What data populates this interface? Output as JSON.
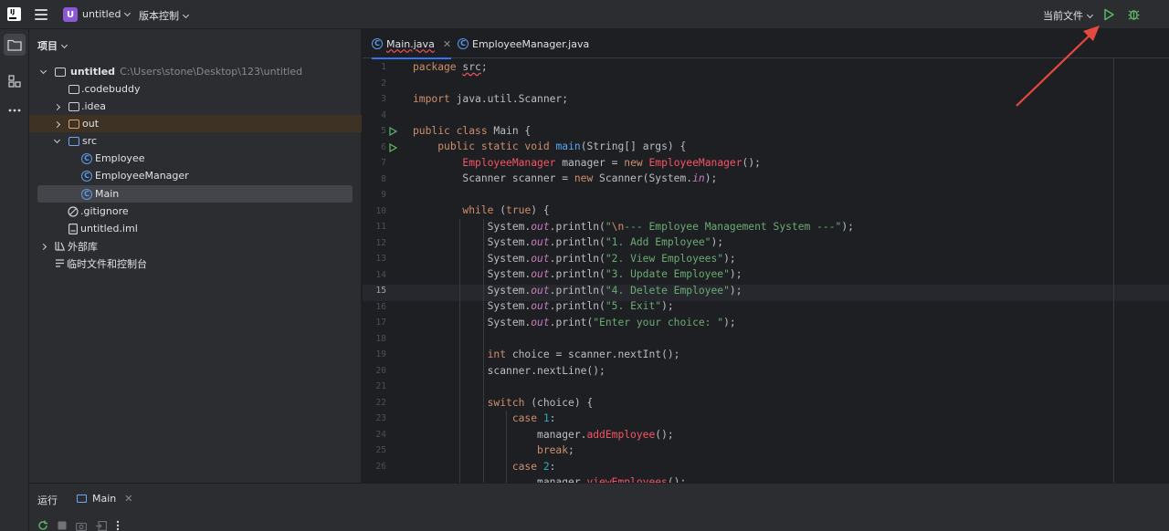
{
  "titlebar": {
    "project_badge": "U",
    "project_name": "untitled",
    "vcs_label": "版本控制",
    "run_config": "当前文件"
  },
  "project_panel": {
    "title": "项目",
    "tree": [
      {
        "label": "untitled",
        "hint": "C:\\Users\\stone\\Desktop\\123\\untitled"
      },
      {
        "label": ".codebuddy"
      },
      {
        "label": ".idea"
      },
      {
        "label": "out"
      },
      {
        "label": "src"
      },
      {
        "label": "Employee"
      },
      {
        "label": "EmployeeManager"
      },
      {
        "label": "Main"
      },
      {
        "label": ".gitignore"
      },
      {
        "label": "untitled.iml"
      },
      {
        "label": "外部库"
      },
      {
        "label": "临时文件和控制台"
      }
    ]
  },
  "editor": {
    "tabs": [
      {
        "label": "Main.java"
      },
      {
        "label": "EmployeeManager.java"
      }
    ],
    "current_line": 15,
    "line_numbers": [
      "1",
      "2",
      "3",
      "4",
      "5",
      "6",
      "7",
      "8",
      "9",
      "10",
      "11",
      "12",
      "13",
      "14",
      "15",
      "16",
      "17",
      "18",
      "19",
      "20",
      "21",
      "22",
      "23",
      "24",
      "25",
      "26"
    ]
  },
  "run_panel": {
    "title": "运行",
    "tab_label": "Main"
  },
  "colors": {
    "accent": "#3574f0",
    "run_green": "#5fb865",
    "badge_purple": "#8c58d6",
    "annotation_arrow": "#e5483f"
  },
  "icons": [
    "app-logo-icon",
    "hamburger-icon",
    "chevron-down-icon",
    "run-icon",
    "debug-icon",
    "folder-icon",
    "structure-icon",
    "more-icon",
    "class-icon",
    "rerun-icon",
    "stop-icon",
    "camera-icon",
    "exit-icon",
    "close-icon"
  ]
}
